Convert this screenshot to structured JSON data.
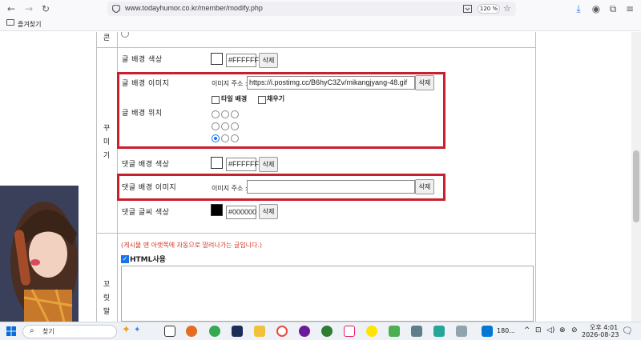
{
  "browser": {
    "url": "www.todayhumor.co.kr/member/modify.php",
    "zoom": "120 %",
    "bookmark_folder": "즐겨찾기"
  },
  "form": {
    "section_top_char": "콘",
    "bg_color_label": "글 배경 색상",
    "bg_color_value": "#FFFFFF",
    "bg_image_label": "글 배경 이미지",
    "image_addr_label": "이미지 주소 :",
    "bg_image_value": "https://i.postimg.cc/B6hyC3Zv/mikangjyang-48.gif",
    "tile_label": "타일 배경",
    "fill_label": "채우기",
    "bg_position_label": "글 배경 위치",
    "comment_bg_color_label": "댓글 배경 색상",
    "comment_bg_color_value": "#FFFFFF",
    "comment_bg_image_label": "댓글 배경 이미지",
    "comment_image_addr_label": "이미지 주소 :",
    "comment_bg_image_value": "",
    "comment_font_color_label": "댓글 글씨 색상",
    "comment_font_color_value": "#000000",
    "delete_label": "삭제",
    "decorate_chars": [
      "꾸",
      "미",
      "기"
    ],
    "signature_chars": [
      "꼬",
      "릿",
      "말"
    ],
    "signature_notice": "(게시물 맨 아랫쪽에 자동으로 말려나가는 글입니다.)",
    "html_label": "HTML사용"
  },
  "taskbar": {
    "search_label": "찾기",
    "weather": "180...",
    "time": "오후 4:01",
    "date": "2026-08-23"
  }
}
